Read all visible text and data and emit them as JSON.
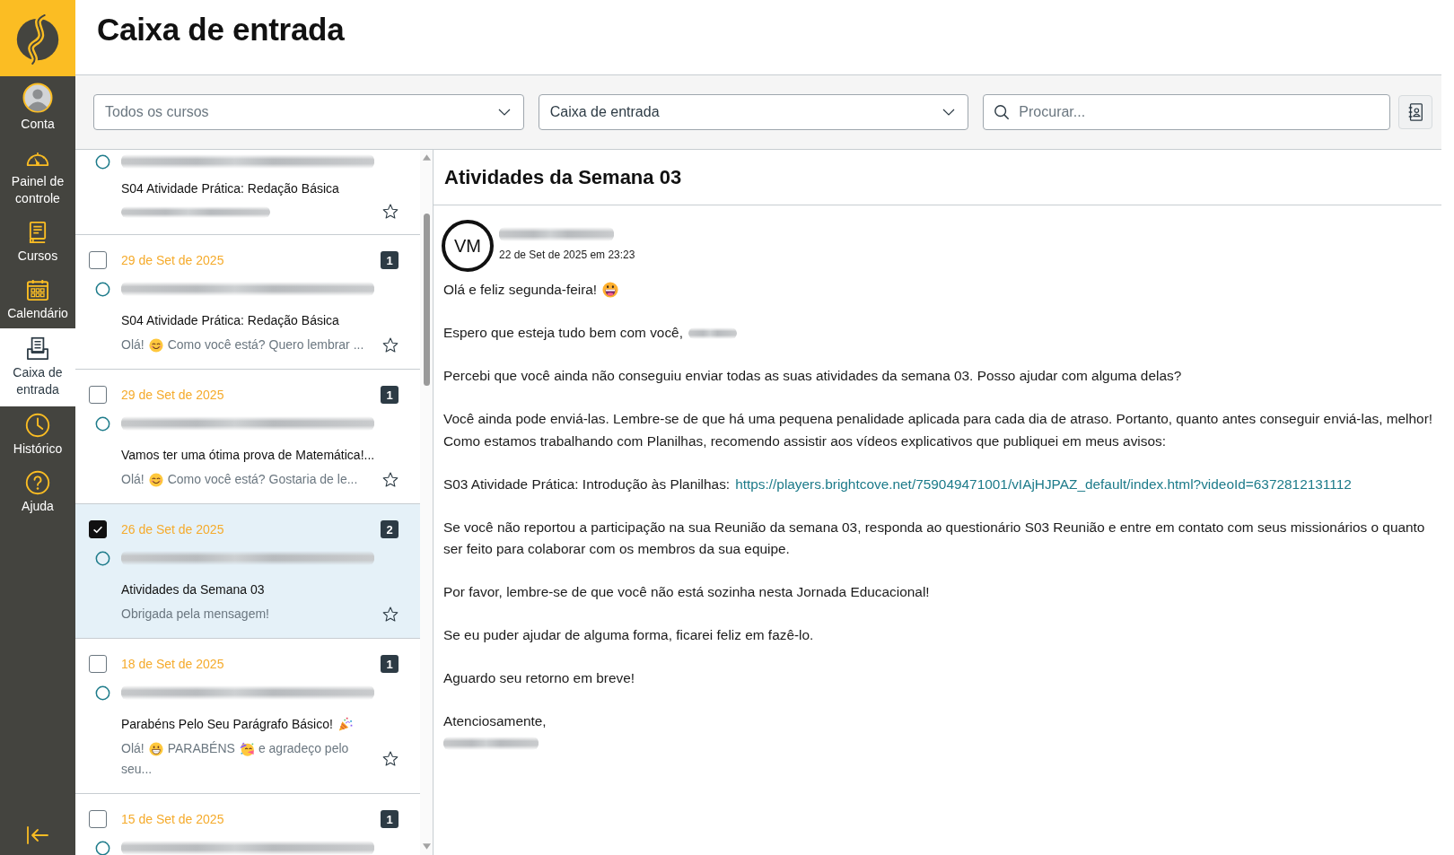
{
  "nav": {
    "items": [
      {
        "label": "Conta",
        "kind": "account",
        "selected": false
      },
      {
        "label": "Painel de controle",
        "kind": "dashboard",
        "selected": false
      },
      {
        "label": "Cursos",
        "kind": "courses",
        "selected": false
      },
      {
        "label": "Calendário",
        "kind": "calendar",
        "selected": false
      },
      {
        "label": "Caixa de entrada",
        "kind": "inbox",
        "selected": true
      },
      {
        "label": "Histórico",
        "kind": "history",
        "selected": false
      },
      {
        "label": "Ajuda",
        "kind": "help",
        "selected": false
      }
    ]
  },
  "page_title": "Caixa de entrada",
  "toolbar": {
    "course_filter": {
      "placeholder": "Todos os cursos"
    },
    "mailbox_filter": {
      "value": "Caixa de entrada"
    },
    "search": {
      "placeholder": "Procurar..."
    }
  },
  "conversations": [
    {
      "participants": [
        {
          "kind": "redacted"
        }
      ],
      "subject": [
        {
          "kind": "text",
          "text": "S04 Atividade Prática: Redação Básica"
        }
      ],
      "preview": [
        {
          "kind": "redacted"
        }
      ],
      "unread": false,
      "starred": false,
      "selected": false
    },
    {
      "checked": false,
      "date": "29 de Set de 2025",
      "count": "1",
      "participants": [
        {
          "kind": "redacted"
        }
      ],
      "subject": [
        {
          "kind": "text",
          "text": "S04 Atividade Prática: Redação Básica"
        }
      ],
      "preview": [
        {
          "kind": "text",
          "text": "Olá!"
        },
        {
          "kind": "smile"
        },
        {
          "kind": "text",
          "text": "Como você está? Quero lembrar ..."
        }
      ],
      "unread": false,
      "starred": false,
      "selected": false
    },
    {
      "checked": false,
      "date": "29 de Set de 2025",
      "count": "1",
      "participants": [
        {
          "kind": "redacted"
        }
      ],
      "subject": [
        {
          "kind": "text",
          "text": "Vamos ter uma ótima prova de Matemática!..."
        }
      ],
      "preview": [
        {
          "kind": "text",
          "text": "Olá!"
        },
        {
          "kind": "smile"
        },
        {
          "kind": "text",
          "text": "Como você está? Gostaria de le..."
        }
      ],
      "unread": false,
      "starred": false,
      "selected": false
    },
    {
      "checked": true,
      "date": "26 de Set de 2025",
      "count": "2",
      "participants": [
        {
          "kind": "redacted"
        }
      ],
      "subject": [
        {
          "kind": "text",
          "text": "Atividades da Semana 03"
        }
      ],
      "preview": [
        {
          "kind": "text",
          "text": "Obrigada pela mensagem!"
        }
      ],
      "unread": false,
      "starred": false,
      "selected": true
    },
    {
      "checked": false,
      "date": "18 de Set de 2025",
      "count": "1",
      "participants": [
        {
          "kind": "redacted"
        }
      ],
      "subject": [
        {
          "kind": "text",
          "text": "Parabéns Pelo Seu Parágrafo Básico!"
        },
        {
          "kind": "confetti"
        }
      ],
      "preview": [
        {
          "kind": "text",
          "text": "Olá!"
        },
        {
          "kind": "grin"
        },
        {
          "kind": "text",
          "text": "PARABÉNS"
        },
        {
          "kind": "party"
        },
        {
          "kind": "text",
          "text": "e agradeço pelo"
        },
        {
          "kind": "text",
          "text": "seu..."
        }
      ],
      "unread": false,
      "starred": false,
      "selected": false
    },
    {
      "checked": false,
      "date": "15 de Set de 2025",
      "count": "1",
      "participants": [
        {
          "kind": "redacted"
        }
      ],
      "unread": false,
      "selected": false
    }
  ],
  "message": {
    "title": "Atividades da Semana 03",
    "sender": {
      "initials": "VM",
      "name": [
        {
          "kind": "redacted"
        }
      ]
    },
    "date": "22 de Set de 2025 em 23:23",
    "body": [
      {
        "lines": [
          [
            {
              "kind": "text",
              "text": "Olá e feliz segunda-feira!"
            },
            {
              "kind": "laugh"
            }
          ]
        ]
      },
      {
        "lines": [
          [
            {
              "kind": "text",
              "text": "Espero que esteja tudo bem com você,"
            },
            {
              "kind": "redacted"
            }
          ]
        ]
      },
      {
        "lines": [
          [
            {
              "kind": "text",
              "text": "Percebi que você ainda não conseguiu enviar todas as suas atividades da semana 03. Posso ajudar com alguma delas?"
            }
          ]
        ]
      },
      {
        "lines": [
          [
            {
              "kind": "text",
              "text": "Você ainda pode enviá-las. Lembre-se de que há uma pequena penalidade aplicada para cada dia de atraso. Portanto, quanto antes conseguir enviá-las, melhor!"
            }
          ],
          [
            {
              "kind": "text",
              "text": "Como estamos trabalhando com Planilhas, recomendo assistir aos vídeos explicativos que publiquei em meus avisos:"
            }
          ]
        ]
      },
      {
        "lines": [
          [
            {
              "kind": "text",
              "text": "S03 Atividade Prática: Introdução às Planilhas:"
            },
            {
              "kind": "link",
              "text": "https://players.brightcove.net/759049471001/vIAjHJPAZ_default/index.html?videoId=6372812131112"
            }
          ]
        ]
      },
      {
        "lines": [
          [
            {
              "kind": "text",
              "text": "Se você não reportou a participação na sua Reunião da semana 03, responda ao questionário S03 Reunião e entre em contato com seus missionários o quanto"
            }
          ],
          [
            {
              "kind": "text",
              "text": "ser feito para colaborar com os membros da sua equipe."
            }
          ]
        ]
      },
      {
        "lines": [
          [
            {
              "kind": "text",
              "text": "Por favor, lembre-se de que você não está sozinha nesta Jornada Educacional!"
            }
          ]
        ]
      },
      {
        "lines": [
          [
            {
              "kind": "text",
              "text": "Se eu puder ajudar de alguma forma, ficarei feliz em fazê-lo."
            }
          ]
        ]
      },
      {
        "lines": [
          [
            {
              "kind": "text",
              "text": "Aguardo seu retorno em breve!"
            }
          ]
        ]
      },
      {
        "lines": [
          [
            {
              "kind": "text",
              "text": "Atenciosamente,"
            }
          ],
          [
            {
              "kind": "redacted"
            }
          ]
        ]
      }
    ]
  }
}
